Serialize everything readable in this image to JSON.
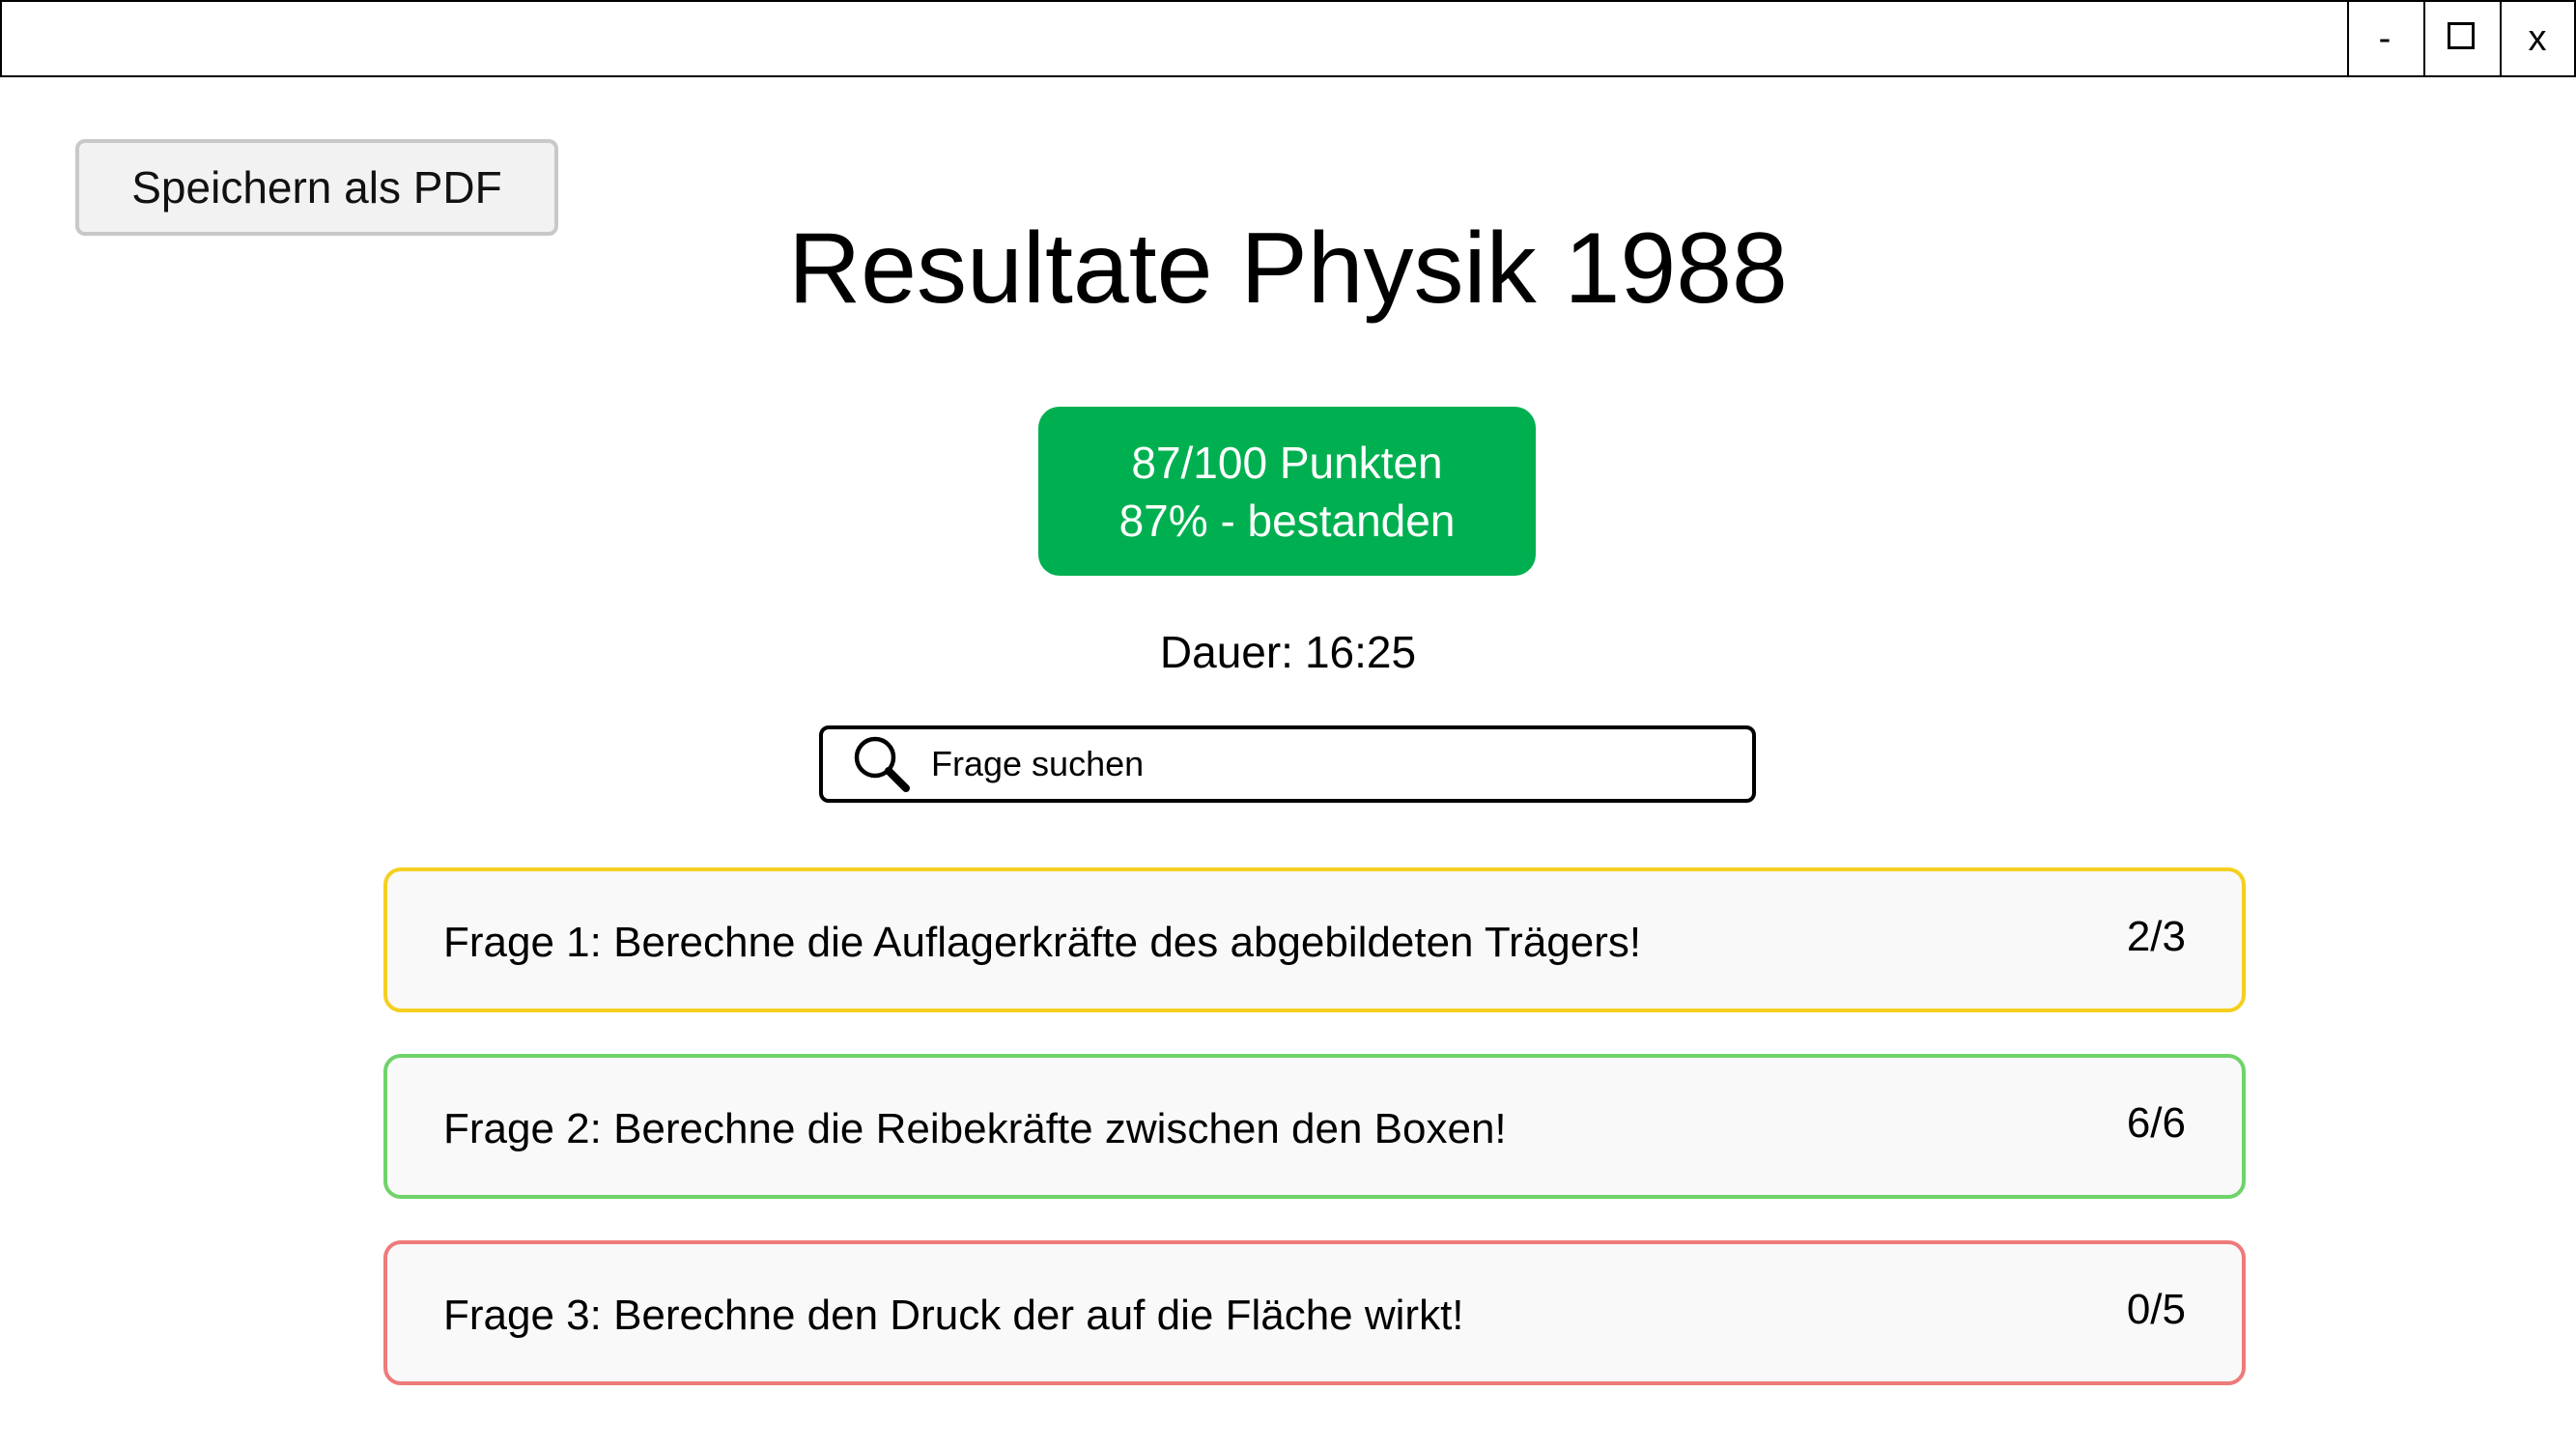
{
  "window": {
    "minimize_label": "-",
    "close_label": "x"
  },
  "toolbar": {
    "save_pdf_label": "Speichern als PDF"
  },
  "page": {
    "title": "Resultate Physik 1988"
  },
  "score": {
    "points": "87/100 Punkten",
    "result": "87% - bestanden",
    "color": "#00b050"
  },
  "duration": {
    "label": "Dauer:",
    "value": "16:25"
  },
  "search": {
    "placeholder": "Frage suchen",
    "icon": "search-icon"
  },
  "questions": [
    {
      "text": "Frage 1: Berechne die Auflagerkräfte des abgebildeten Trägers!",
      "score": "2/3",
      "status_color": "#f5cf1f"
    },
    {
      "text": "Frage 2: Berechne die Reibekräfte zwischen den Boxen!",
      "score": "6/6",
      "status_color": "#6fd36a"
    },
    {
      "text": "Frage 3: Berechne den Druck der auf die Fläche wirkt!",
      "score": "0/5",
      "status_color": "#ee7a7a"
    }
  ]
}
